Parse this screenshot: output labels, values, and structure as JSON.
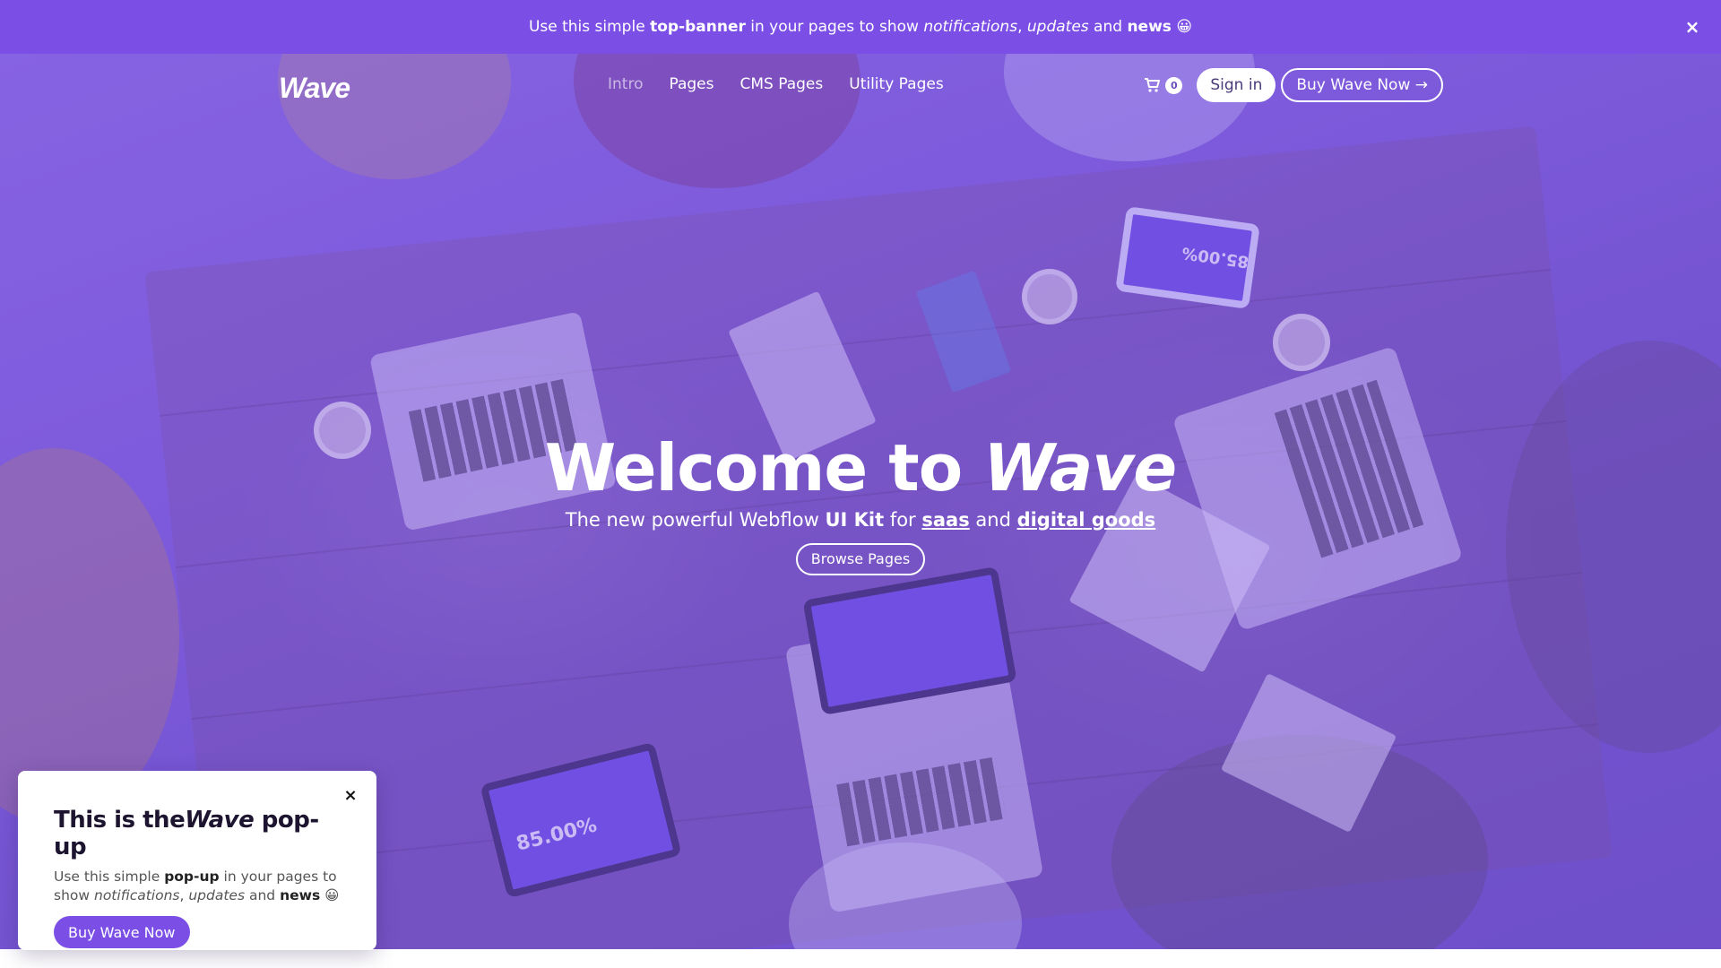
{
  "top_banner": {
    "text_before": "Use this simple ",
    "text_bold": "top-banner",
    "text_mid": " in your pages to show ",
    "text_italic1": "notifications",
    "text_comma": ", ",
    "text_italic2": "updates",
    "text_and": " and ",
    "text_bold2": "news",
    "emoji": "😀",
    "close_label": "×"
  },
  "nav": {
    "logo": "Wave",
    "links": [
      {
        "label": "Intro",
        "active": true
      },
      {
        "label": "Pages"
      },
      {
        "label": "CMS Pages"
      },
      {
        "label": "Utility Pages"
      }
    ],
    "cart_count": "0",
    "signin_label": "Sign in",
    "buy_label": "Buy Wave Now →"
  },
  "hero": {
    "title_prefix": "Welcome to ",
    "title_brand": "Wave",
    "sub_a": "The new powerful Webflow ",
    "sub_b": "UI Kit",
    "sub_c": " for ",
    "sub_d": "saas",
    "sub_e": " and ",
    "sub_f": "digital goods",
    "browse_label": "Browse Pages",
    "screen_text_1": "85.00%",
    "screen_text_2": "85.00%"
  },
  "popup": {
    "close_label": "×",
    "title_prefix": "This is the",
    "title_brand": "Wave",
    "title_suffix": " pop-up",
    "text_a": "Use this simple ",
    "text_b": "pop-up",
    "text_c": " in your pages to show ",
    "text_d": "notifications",
    "text_e": ", ",
    "text_f": "updates",
    "text_g": " and ",
    "text_h": "news",
    "emoji": "😀",
    "buy_label": "Buy Wave Now"
  },
  "colors": {
    "brand_purple": "#7b4fe6",
    "white": "#ffffff"
  }
}
